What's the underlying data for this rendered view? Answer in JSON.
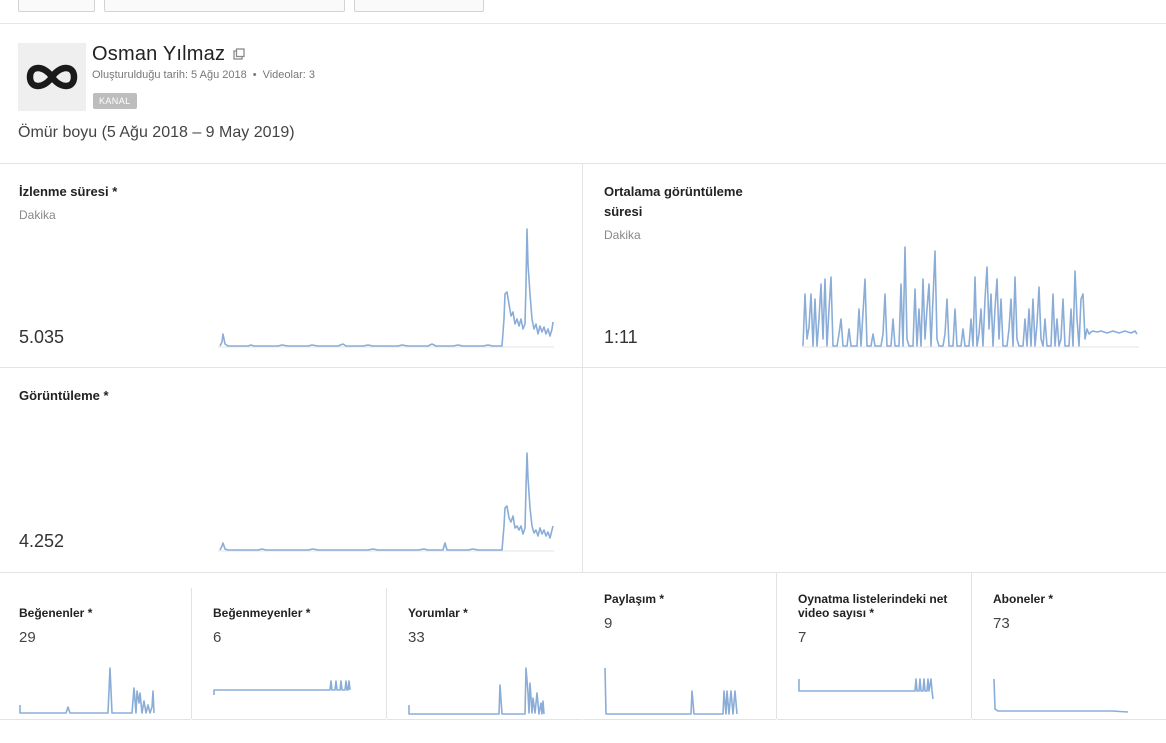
{
  "channel": {
    "name": "Osman Yılmaz",
    "created_label": "Oluşturulduğu tarih: 5 Ağu 2018",
    "videos_label": "Videolar: 3",
    "badge": "KANAL",
    "range": "Ömür boyu (5 Ağu 2018 – 9 May 2019)"
  },
  "icons": {
    "avatar": "infinity-icon",
    "external": "external-link-icon"
  },
  "colors": {
    "sparkline": "#8aadd8"
  },
  "metrics": {
    "watch_time": {
      "title": "İzlenme süresi *",
      "unit": "Dakika",
      "value": "5.035"
    },
    "avg_view_duration": {
      "title": "Ortalama görüntüleme süresi",
      "unit": "Dakika",
      "value": "1:11"
    },
    "views": {
      "title": "Görüntüleme *",
      "value": "4.252"
    },
    "likes": {
      "title": "Beğenenler *",
      "value": "29"
    },
    "dislikes": {
      "title": "Beğenmeyenler *",
      "value": "6"
    },
    "comments": {
      "title": "Yorumlar *",
      "value": "33"
    },
    "shares": {
      "title": "Paylaşım *",
      "value": "9"
    },
    "playlist_videos": {
      "title": "Oynatma listelerindeki net video sayısı *",
      "value": "7"
    },
    "subscribers": {
      "title": "Aboneler *",
      "value": "73"
    }
  }
}
